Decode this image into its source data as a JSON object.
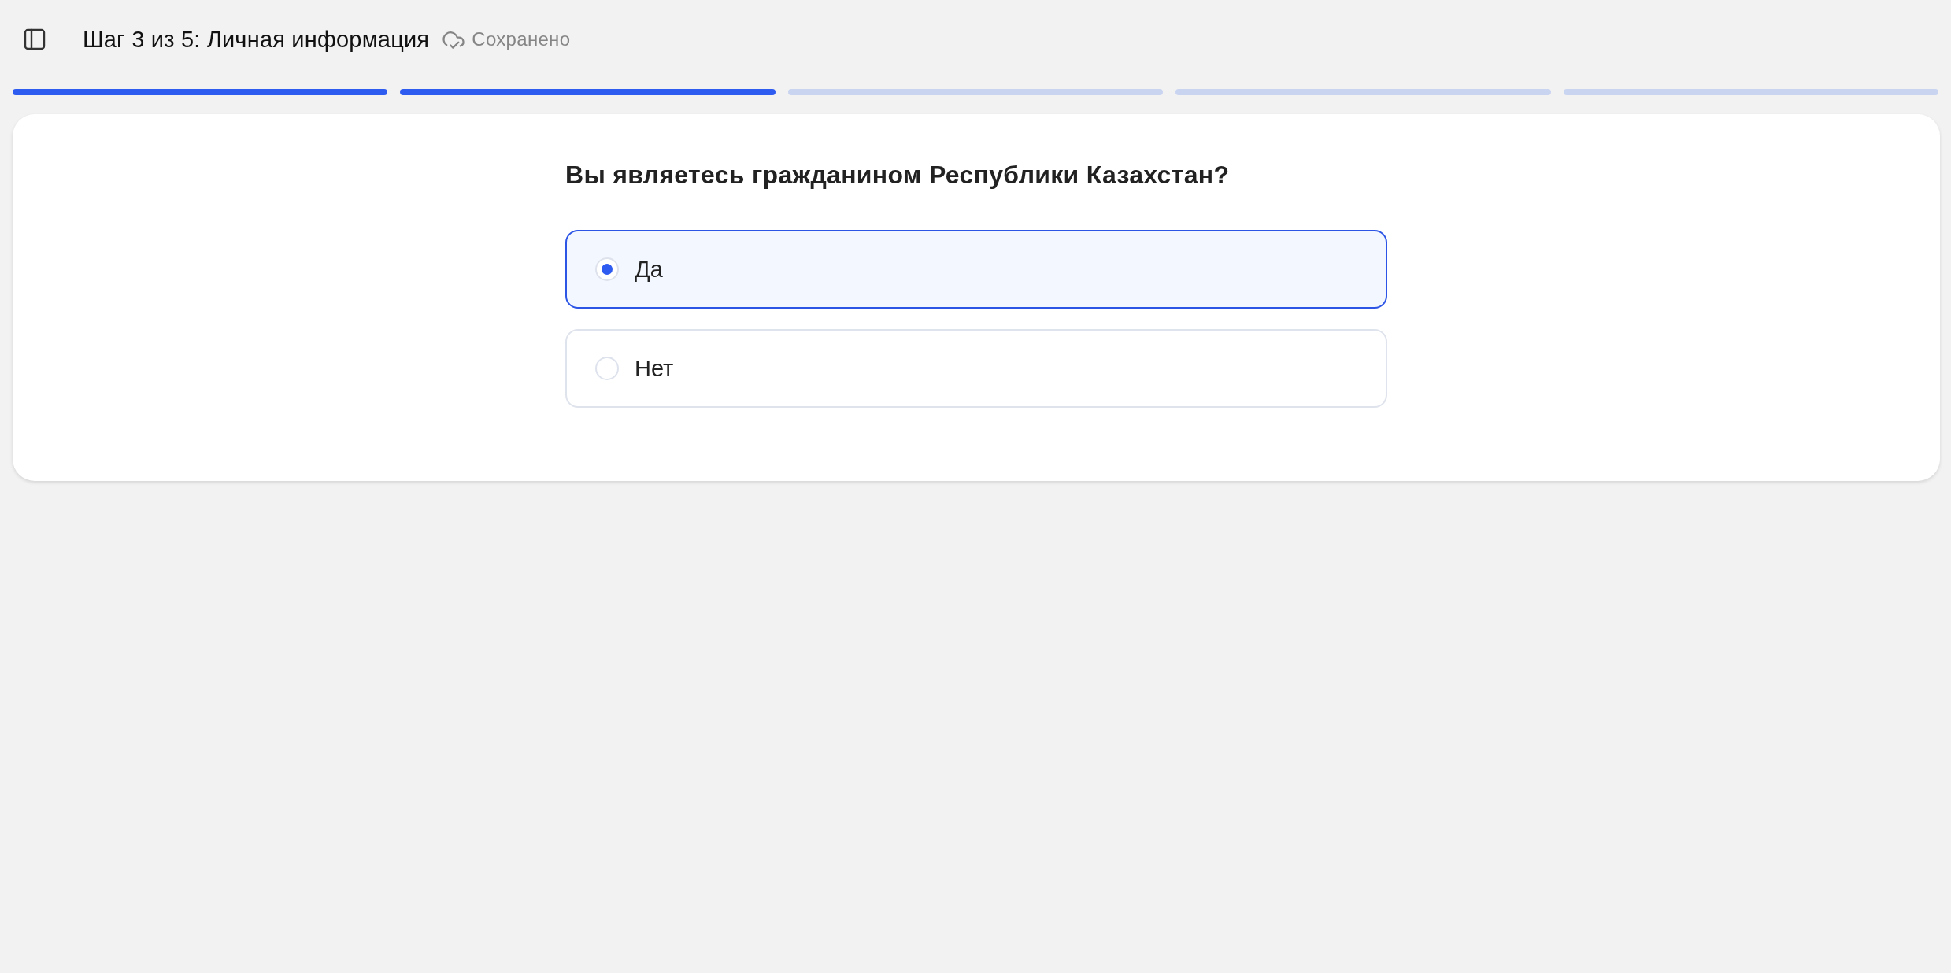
{
  "header": {
    "title": "Шаг 3 из 5: Личная информация",
    "save_status": "Сохранено"
  },
  "progress": {
    "steps": [
      {
        "completed": true
      },
      {
        "completed": true
      },
      {
        "completed": false
      },
      {
        "completed": false
      },
      {
        "completed": false
      }
    ]
  },
  "question": {
    "text": "Вы являетесь гражданином Республики Казахстан?",
    "options": [
      {
        "label": "Да",
        "selected": true
      },
      {
        "label": "Нет",
        "selected": false
      }
    ]
  }
}
